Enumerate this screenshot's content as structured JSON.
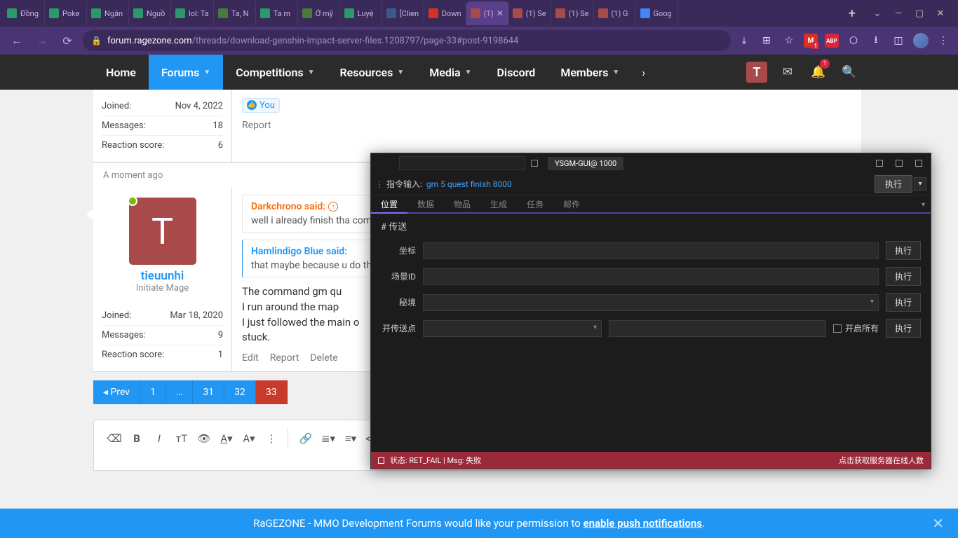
{
  "browser": {
    "tabs": [
      {
        "label": "Đồng",
        "favicon": "#2a9a6a"
      },
      {
        "label": "Poke",
        "favicon": "#2a9a6a"
      },
      {
        "label": "Ngân",
        "favicon": "#2a9a6a"
      },
      {
        "label": "Nguồ",
        "favicon": "#2a9a6a"
      },
      {
        "label": "lol: Ta",
        "favicon": "#2a9a6a"
      },
      {
        "label": "Ta, N",
        "favicon": "#4a7a3a"
      },
      {
        "label": "Ta m",
        "favicon": "#2a9a6a"
      },
      {
        "label": "Ở mỹ",
        "favicon": "#4a7a3a"
      },
      {
        "label": "Luyệ",
        "favicon": "#2a9a6a"
      },
      {
        "label": "[Clien",
        "favicon": "#3a5a8a"
      },
      {
        "label": "Down",
        "favicon": "#d93025"
      },
      {
        "label": "(1)",
        "favicon": "#a84a4a",
        "active": true
      },
      {
        "label": "(1) Se",
        "favicon": "#a84a4a"
      },
      {
        "label": "(1) Se",
        "favicon": "#a84a4a"
      },
      {
        "label": "(1) G",
        "favicon": "#a84a4a"
      },
      {
        "label": "Goog",
        "favicon": "#4285F4"
      }
    ],
    "url_domain": "forum.ragezone.com",
    "url_path": "/threads/download-genshin-impact-server-files.1208797/page-33#post-9198644"
  },
  "site_nav": {
    "items": [
      "Home",
      "Forums",
      "Competitions",
      "Resources",
      "Media",
      "Discord",
      "Members"
    ],
    "active": 1,
    "avatar_letter": "T",
    "alert_count": "1"
  },
  "post1": {
    "stats": {
      "joined_l": "Joined:",
      "joined_v": "Nov 4, 2022",
      "msgs_l": "Messages:",
      "msgs_v": "18",
      "react_l": "Reaction score:",
      "react_v": "6"
    },
    "like_you": "You",
    "report": "Report",
    "timestamp": "A moment ago"
  },
  "post2": {
    "user": {
      "name": "tieuunhi",
      "rank": "Initiate Mage",
      "letter": "T"
    },
    "stats": {
      "joined_l": "Joined:",
      "joined_v": "Mar 18, 2020",
      "msgs_l": "Messages:",
      "msgs_v": "9",
      "react_l": "Reaction score:",
      "react_v": "1"
    },
    "q1_head": "Darkchrono said:",
    "q1_body": "well i already finish tha command to finish qu",
    "q2_head": "Hamlindigo Blue said:",
    "q2_body": "that maybe because u do the job.",
    "body": "The command gm qu\nI run around the map\nI just followed the main o\nstuck.",
    "actions": {
      "edit": "Edit",
      "report": "Report",
      "delete": "Delete"
    }
  },
  "pager": {
    "prev": "Prev",
    "pages": [
      "1",
      "…",
      "31",
      "32",
      "33"
    ]
  },
  "editor": {
    "preview": "Preview"
  },
  "notif": {
    "text_prefix": "RaGEZONE - MMO Development Forums would like your permission to ",
    "link": "enable push notifications",
    "suffix": "."
  },
  "overlay": {
    "title": "YSGM-GUI@ 1000",
    "cmd_label": "指令输入:",
    "cmd_value": "gm 5 quest finish 8000",
    "exec": "执行",
    "tabs": [
      "位置",
      "数据",
      "物品",
      "生成",
      "任务",
      "邮件"
    ],
    "section": "# 传送",
    "rows": {
      "coord": {
        "label": "坐标",
        "btn": "执行"
      },
      "scene": {
        "label": "场景ID",
        "btn": "执行"
      },
      "realm": {
        "label": "秘境",
        "btn": "执行"
      },
      "tp": {
        "label": "开传送点",
        "chk": "开启所有",
        "btn": "执行"
      }
    },
    "status_left": "状态: RET_FAIL | Msg: 失败",
    "status_right": "点击获取服务器在线人数"
  }
}
